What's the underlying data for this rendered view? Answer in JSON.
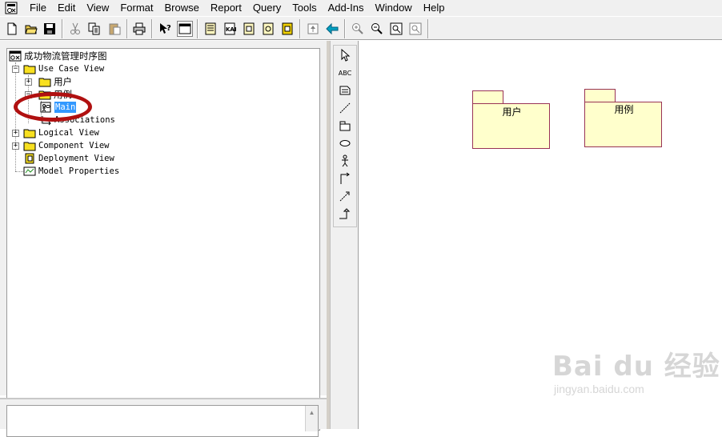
{
  "menubar": {
    "items": [
      "File",
      "Edit",
      "View",
      "Format",
      "Browse",
      "Report",
      "Query",
      "Tools",
      "Add-Ins",
      "Window",
      "Help"
    ]
  },
  "toolbar": {
    "buttons": [
      "new-document-icon",
      "open-folder-icon",
      "save-icon",
      "cut-icon",
      "copy-icon",
      "paste-icon",
      "print-icon",
      "context-help-icon",
      "view-doc-icon",
      "class-diagram-icon",
      "interaction-diagram-icon",
      "component-diagram-icon",
      "state-diagram-icon",
      "deployment-diagram-icon",
      "browse-parent-icon",
      "browse-previous-icon",
      "zoom-in-icon",
      "zoom-out-icon",
      "fit-in-window-icon",
      "undo-fit-icon"
    ]
  },
  "browser": {
    "root": "成功物流管理时序图",
    "items": [
      {
        "label": "Use Case View",
        "icon": "folder-icon",
        "expander": "−"
      },
      {
        "label": "用户",
        "icon": "folder-icon",
        "expander": "+"
      },
      {
        "label": "用例",
        "icon": "folder-icon",
        "expander": "−"
      },
      {
        "label": "Main",
        "icon": "use-case-diagram-icon",
        "selected": true
      },
      {
        "label": "Associations",
        "icon": "association-icon"
      },
      {
        "label": "Logical View",
        "icon": "folder-icon",
        "expander": "+"
      },
      {
        "label": "Component View",
        "icon": "folder-icon",
        "expander": "+"
      },
      {
        "label": "Deployment View",
        "icon": "deployment-view-icon"
      },
      {
        "label": "Model Properties",
        "icon": "model-properties-icon"
      }
    ]
  },
  "palette": {
    "tools": [
      "selection-arrow-icon",
      "text-box-icon",
      "note-icon",
      "anchor-note-icon",
      "package-icon",
      "use-case-icon",
      "actor-icon",
      "unidirectional-association-icon",
      "dependency-icon",
      "generalization-icon"
    ],
    "text_tool_label": "ABC"
  },
  "diagram": {
    "packages": [
      {
        "name": "用户"
      },
      {
        "name": "用例"
      }
    ]
  },
  "watermark": {
    "main": "Bai du 经验",
    "url": "jingyan.baidu.com"
  },
  "colors": {
    "package_fill": "#ffffcc",
    "package_border": "#993355",
    "selection": "#3399ff",
    "highlight_ring": "#b01010"
  }
}
